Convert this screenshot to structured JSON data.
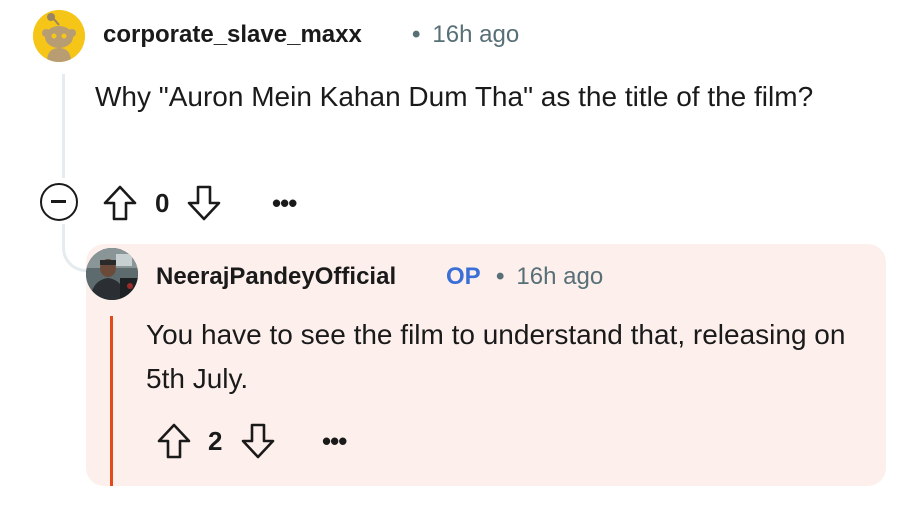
{
  "comment": {
    "author": "corporate_slave_maxx",
    "dot": "•",
    "time": "16h ago",
    "body": "Why \"Auron Mein Kahan Dum Tha\" as the title of the film?",
    "score": "0",
    "more": "•••",
    "avatar_color": "#f5c518"
  },
  "reply": {
    "author": "NeerajPandeyOfficial",
    "badge": "OP",
    "dot": "•",
    "time": "16h ago",
    "body": "You have to see the film to understand that, releasing on 5th July.",
    "score": "2",
    "more": "•••",
    "card_color": "#fdf0ec",
    "accent_color": "#e24a1a",
    "badge_color": "#3a6fd8"
  }
}
